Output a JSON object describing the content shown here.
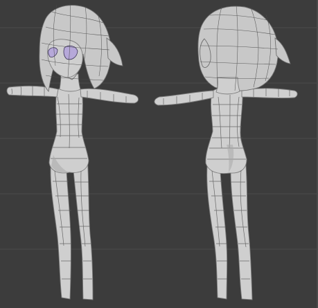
{
  "viewport": {
    "background": "#3c3c3c",
    "mesh_color": "#cfcfcf",
    "wire_color": "#555555",
    "eye_color": "#b6a8d9"
  },
  "models": [
    {
      "view": "front",
      "icon": "character-mesh-front"
    },
    {
      "view": "back",
      "icon": "character-mesh-back"
    }
  ]
}
